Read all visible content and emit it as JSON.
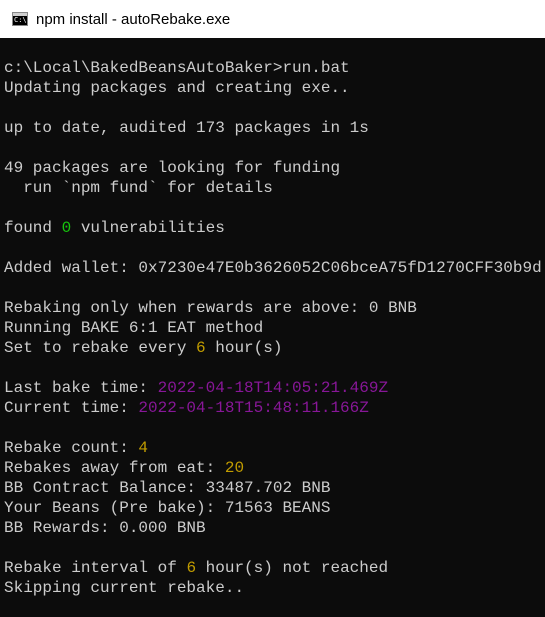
{
  "window": {
    "title": "npm install - autoRebake.exe"
  },
  "console": {
    "prompt": "c:\\Local\\BakedBeansAutoBaker>run.bat",
    "updating": "Updating packages and creating exe..",
    "audit": "up to date, audited 173 packages in 1s",
    "funding": "49 packages are looking for funding",
    "fund_details": "  run `npm fund` for details",
    "vuln_prefix": "found ",
    "vuln_count": "0",
    "vuln_suffix": " vulnerabilities",
    "wallet": "Added wallet: 0x7230e47E0b3626052C06bceA75fD1270CFF30b9d",
    "rebake_threshold": "Rebaking only when rewards are above: 0 BNB",
    "method": "Running BAKE 6:1 EAT method",
    "interval_prefix": "Set to rebake every ",
    "interval_value": "6",
    "interval_suffix": " hour(s)",
    "last_bake_label": "Last bake time: ",
    "last_bake_value": "2022-04-18T14:05:21.469Z",
    "current_time_label": "Current time: ",
    "current_time_value": "2022-04-18T15:48:11.166Z",
    "rebake_count_label": "Rebake count: ",
    "rebake_count_value": "4",
    "rebakes_away_label": "Rebakes away from eat: ",
    "rebakes_away_value": "20",
    "contract_balance": "BB Contract Balance: 33487.702 BNB",
    "your_beans": "Your Beans (Pre bake): 71563 BEANS",
    "rewards": "BB Rewards: 0.000 BNB",
    "not_reached_prefix": "Rebake interval of ",
    "not_reached_value": "6",
    "not_reached_suffix": " hour(s) not reached",
    "skipping": "Skipping current rebake.."
  },
  "colors": {
    "background": "#0c0c0c",
    "text": "#cccccc",
    "green": "#16c60c",
    "yellow": "#c19c00",
    "magenta": "#881798"
  },
  "icons": {
    "app": "console-window-icon"
  }
}
